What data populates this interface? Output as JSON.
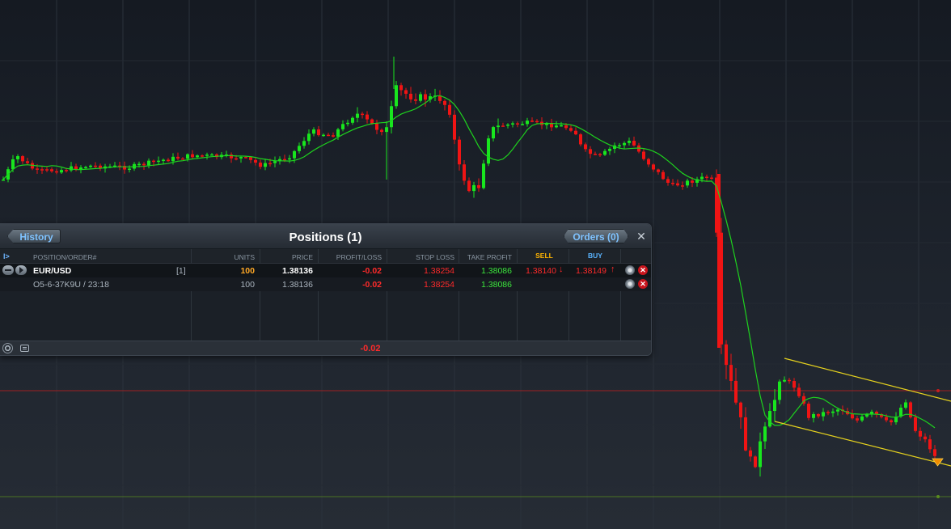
{
  "colors": {
    "bull": "#18e61e",
    "bear": "#f01414",
    "moving_average": "#1ed21e",
    "channel": "#e6d21e",
    "price_line": "#c81e1e",
    "low_line": "#5a8c1e",
    "profit_loss_negative": "#ff2a2a",
    "take_profit": "#3ce63c",
    "units": "#ffa826",
    "header_accent": "#ffb400",
    "buy_header": "#5ab4ff",
    "button_text": "#7fc3ff"
  },
  "chart_data": {
    "type": "candlestick",
    "series": [],
    "horizontal_lines": [
      {
        "name": "current-price"
      },
      {
        "name": "support"
      }
    ],
    "overlays": [
      "moving-average",
      "descending-channel"
    ],
    "grid": true
  },
  "positions_panel": {
    "title": "Positions (1)",
    "history_label": "History",
    "orders_label": "Orders (0)",
    "close_glyph": "✕",
    "expand_glyph": "I>",
    "columns": {
      "position": "POSITION/ORDER#",
      "units": "UNITS",
      "price": "PRICE",
      "profit_loss": "PROFIT/LOSS",
      "stop_loss": "STOP LOSS",
      "take_profit": "TAKE PROFIT",
      "sell": "SELL",
      "buy": "BUY"
    },
    "rows": [
      {
        "symbol": "EUR/USD",
        "count": "[1]",
        "units": "100",
        "price": "1.38136",
        "profit_loss": "-0.02",
        "stop_loss": "1.38254",
        "take_profit": "1.38086",
        "sell": "1.38140",
        "buy": "1.38149"
      },
      {
        "order": "O5-6-37K9U / 23:18",
        "units": "100",
        "price": "1.38136",
        "profit_loss": "-0.02",
        "stop_loss": "1.38254",
        "take_profit": "1.38086"
      }
    ],
    "total_profit_loss": "-0.02"
  }
}
